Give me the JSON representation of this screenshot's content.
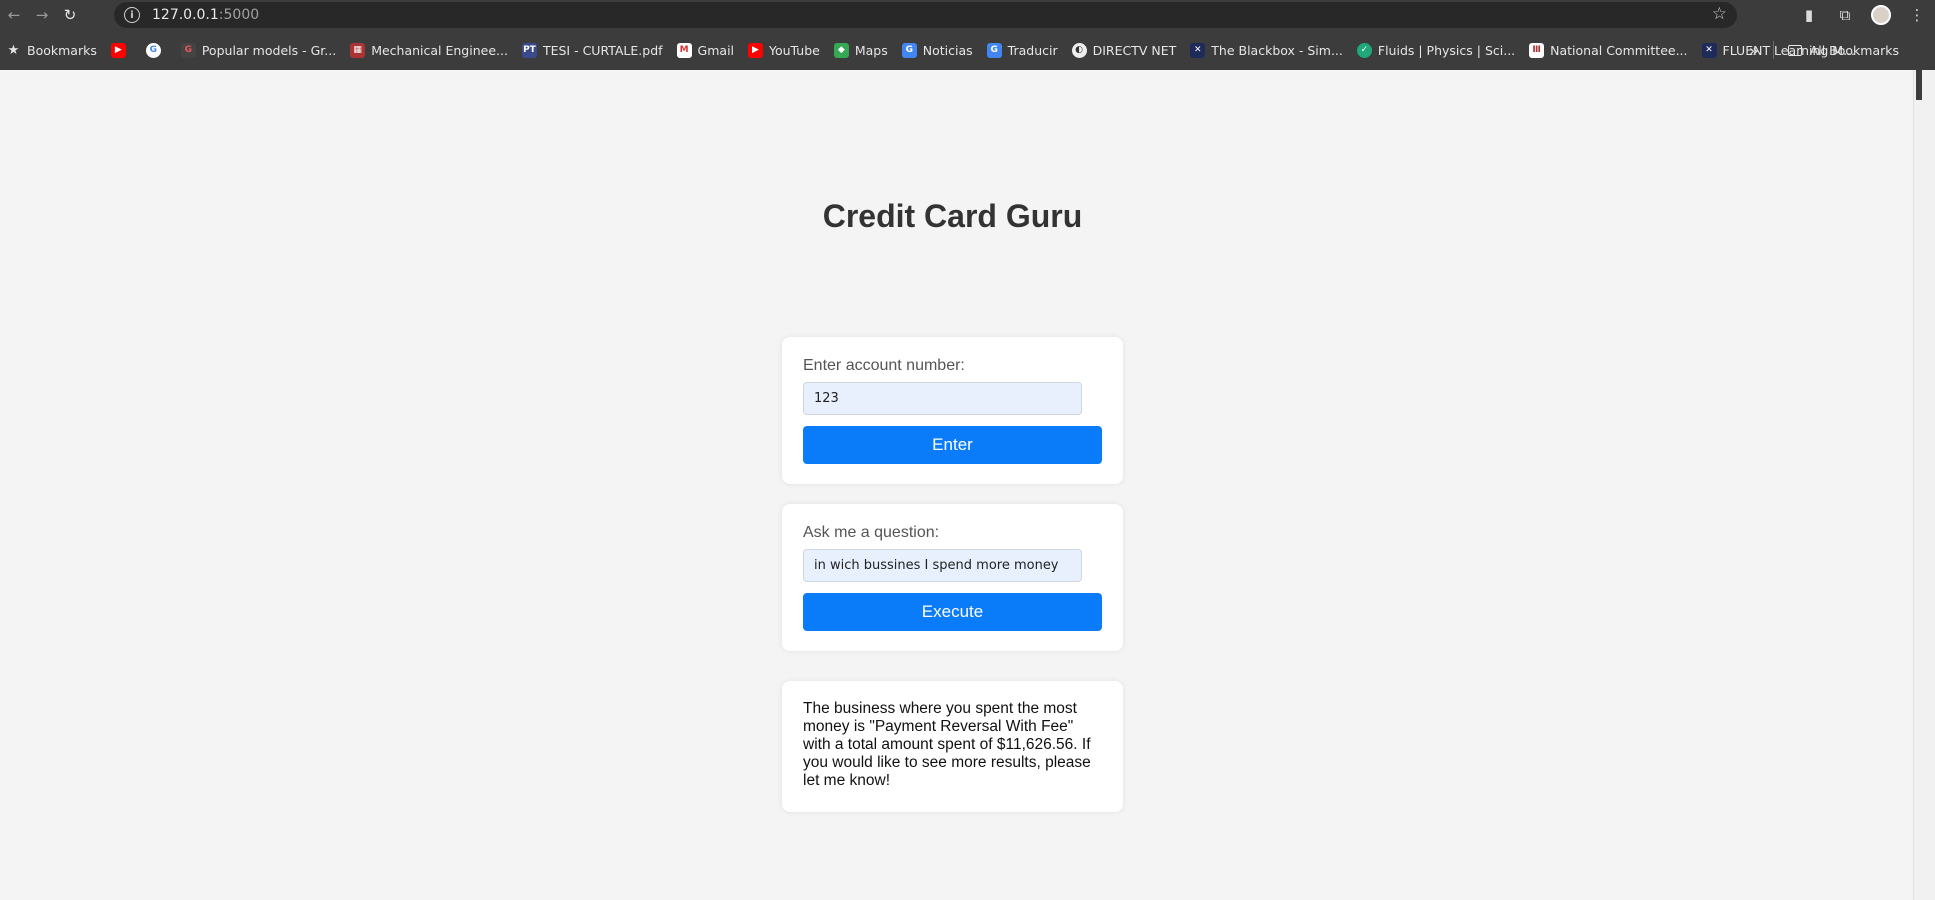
{
  "browser": {
    "url_host": "127.0.0.1",
    "url_port": ":5000",
    "bookmarks": [
      {
        "label": "Bookmarks",
        "icon": "star-icon"
      },
      {
        "label": "",
        "icon": "youtube-icon"
      },
      {
        "label": "",
        "icon": "google-icon"
      },
      {
        "label": "Popular models - Gr...",
        "icon": "gr-icon"
      },
      {
        "label": "Mechanical Enginee...",
        "icon": "mech-icon"
      },
      {
        "label": "TESI - CURTALE.pdf",
        "icon": "pt-icon"
      },
      {
        "label": "Gmail",
        "icon": "gmail-icon"
      },
      {
        "label": "YouTube",
        "icon": "youtube-icon"
      },
      {
        "label": "Maps",
        "icon": "maps-icon"
      },
      {
        "label": "Noticias",
        "icon": "news-icon"
      },
      {
        "label": "Traducir",
        "icon": "translate-icon"
      },
      {
        "label": "DIRECTV NET",
        "icon": "directv-icon"
      },
      {
        "label": "The Blackbox - Sim...",
        "icon": "blackbox-icon"
      },
      {
        "label": "Fluids | Physics | Sci...",
        "icon": "fluids-icon"
      },
      {
        "label": "National Committee...",
        "icon": "committee-icon"
      },
      {
        "label": "FLUENT Learning M...",
        "icon": "fluent-icon"
      }
    ],
    "all_bookmarks": "All Bookmarks"
  },
  "app": {
    "title": "Credit Card Guru",
    "account": {
      "label": "Enter account number:",
      "value": "123",
      "button": "Enter"
    },
    "question": {
      "label": "Ask me a question:",
      "value": "in wich bussines I spend more money",
      "button": "Execute"
    },
    "answer": "The business where you spent the most money is \"Payment Reversal With Fee\" with a total amount spent of $11,626.56. If you would like to see more results, please let me know!"
  }
}
